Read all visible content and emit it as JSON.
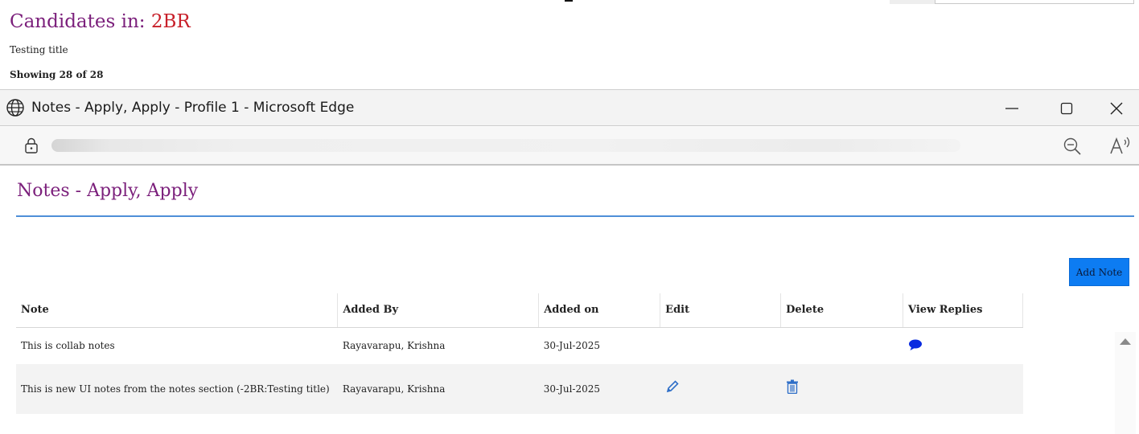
{
  "background_page": {
    "title_prefix": "Candidates in: ",
    "title_highlight": "2BR",
    "subtitle": "Testing title",
    "showing": "Showing 28 of 28"
  },
  "window": {
    "title": "Notes - Apply, Apply - Profile 1 - Microsoft Edge"
  },
  "page": {
    "heading": "Notes - Apply, Apply",
    "add_note_label": "Add Note",
    "accent_color": "#0d7cf2",
    "heading_color": "#7b1f7b"
  },
  "table": {
    "headers": {
      "note": "Note",
      "added_by": "Added By",
      "added_on": "Added on",
      "edit": "Edit",
      "delete": "Delete",
      "view_replies": "View Replies"
    },
    "rows": [
      {
        "note": "This is collab notes",
        "added_by": "Rayavarapu, Krishna",
        "added_on": "30-Jul-2025",
        "edit_icon": "",
        "delete_icon": "",
        "replies_icon": "speech-bubble-icon"
      },
      {
        "note": "This is new UI notes from the notes section (-2BR:Testing title)",
        "added_by": "Rayavarapu, Krishna",
        "added_on": "30-Jul-2025",
        "edit_icon": "pencil-icon",
        "delete_icon": "trash-icon",
        "replies_icon": ""
      }
    ]
  }
}
